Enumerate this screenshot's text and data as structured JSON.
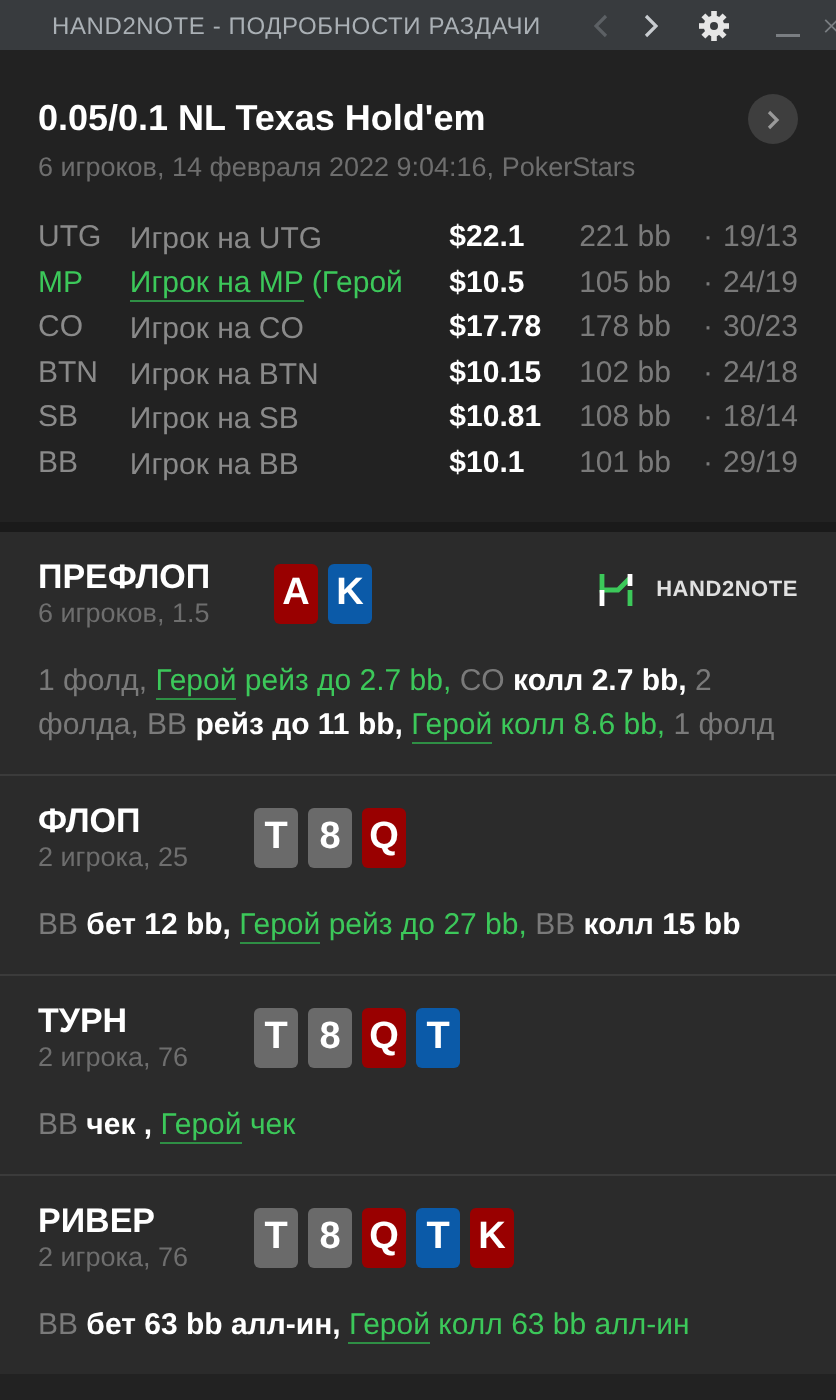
{
  "window": {
    "title": "HAND2NOTE - ПОДРОБНОСТИ РАЗДАЧИ",
    "prev_disabled": true,
    "next_disabled": false
  },
  "hand": {
    "title": "0.05/0.1 NL Texas Hold'em",
    "subtitle": "6 игроков, 14 февраля 2022 9:04:16, PokerStars",
    "players": [
      {
        "position": "UTG",
        "name": "Игрок на UTG",
        "hero": false,
        "stack": "$22.1",
        "bb": "221 bb",
        "separator": "·",
        "stats": "19/13"
      },
      {
        "position": "MP",
        "name": "Игрок на MP",
        "note": "(Герой",
        "hero": true,
        "stack": "$10.5",
        "bb": "105 bb",
        "separator": "·",
        "stats": "24/19"
      },
      {
        "position": "CO",
        "name": "Игрок на CO",
        "hero": false,
        "stack": "$17.78",
        "bb": "178 bb",
        "separator": "·",
        "stats": "30/23"
      },
      {
        "position": "BTN",
        "name": "Игрок на BTN",
        "hero": false,
        "stack": "$10.15",
        "bb": "102 bb",
        "separator": "·",
        "stats": "24/18"
      },
      {
        "position": "SB",
        "name": "Игрок на SB",
        "hero": false,
        "stack": "$10.81",
        "bb": "108 bb",
        "separator": "·",
        "stats": "18/14"
      },
      {
        "position": "BB",
        "name": "Игрок на BB",
        "hero": false,
        "stack": "$10.1",
        "bb": "101 bb",
        "separator": "·",
        "stats": "29/19"
      }
    ]
  },
  "streets": [
    {
      "name": "ПРЕФЛОП",
      "info": "6 игроков, 1.5",
      "logo": {
        "text": "HAND2NOTE"
      },
      "cards": [
        {
          "rank": "A",
          "color": "#990000"
        },
        {
          "rank": "K",
          "color": "#0b5aa8"
        }
      ],
      "actions": [
        {
          "kind": "muted",
          "text": "1 фолд, "
        },
        {
          "kind": "hero_link",
          "text": "Герой"
        },
        {
          "kind": "hero",
          "text": " рейз до 2.7 bb,"
        },
        {
          "kind": "muted",
          "text": " CO"
        },
        {
          "kind": "bold",
          "text": " колл 2.7 bb,"
        },
        {
          "kind": "muted",
          "text": " 2 фолда, BB"
        },
        {
          "kind": "bold",
          "text": " рейз до 11 bb, "
        },
        {
          "kind": "hero_link",
          "text": "Герой"
        },
        {
          "kind": "hero",
          "text": " колл 8.6 bb,"
        },
        {
          "kind": "muted",
          "text": " 1 фолд"
        }
      ]
    },
    {
      "name": "ФЛОП",
      "info": "2 игрока, 25",
      "cards": [
        {
          "rank": "T",
          "color": "#6a6a6a"
        },
        {
          "rank": "8",
          "color": "#6a6a6a"
        },
        {
          "rank": "Q",
          "color": "#990000"
        }
      ],
      "actions": [
        {
          "kind": "muted",
          "text": "BB"
        },
        {
          "kind": "bold",
          "text": " бет 12 bb, "
        },
        {
          "kind": "hero_link",
          "text": "Герой"
        },
        {
          "kind": "hero",
          "text": " рейз до 27 bb,"
        },
        {
          "kind": "muted",
          "text": " BB"
        },
        {
          "kind": "bold",
          "text": " колл 15 bb"
        }
      ]
    },
    {
      "name": "ТУРН",
      "info": "2 игрока, 76",
      "cards": [
        {
          "rank": "T",
          "color": "#6a6a6a"
        },
        {
          "rank": "8",
          "color": "#6a6a6a"
        },
        {
          "rank": "Q",
          "color": "#990000"
        },
        {
          "rank": "T",
          "color": "#0b5aa8"
        }
      ],
      "actions": [
        {
          "kind": "muted",
          "text": "BB"
        },
        {
          "kind": "bold",
          "text": " чек , "
        },
        {
          "kind": "hero_link",
          "text": "Герой"
        },
        {
          "kind": "hero",
          "text": " чек"
        }
      ]
    },
    {
      "name": "РИВЕР",
      "info": "2 игрока, 76",
      "cards": [
        {
          "rank": "T",
          "color": "#6a6a6a"
        },
        {
          "rank": "8",
          "color": "#6a6a6a"
        },
        {
          "rank": "Q",
          "color": "#990000"
        },
        {
          "rank": "T",
          "color": "#0b5aa8"
        },
        {
          "rank": "K",
          "color": "#990000"
        }
      ],
      "actions": [
        {
          "kind": "muted",
          "text": "BB"
        },
        {
          "kind": "bold",
          "text": " бет 63 bb алл-ин, "
        },
        {
          "kind": "hero_link",
          "text": "Герой"
        },
        {
          "kind": "hero",
          "text": " колл 63 bb алл-ин"
        }
      ]
    }
  ]
}
